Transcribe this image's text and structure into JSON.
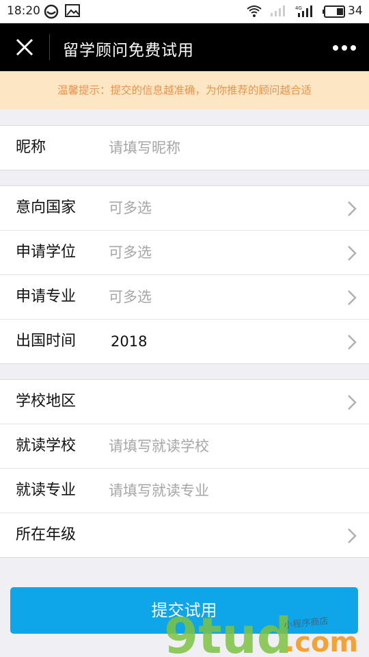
{
  "status_bar": {
    "time": "18:20",
    "battery": "34"
  },
  "header": {
    "title": "留学顾问免费试用"
  },
  "notice": {
    "text": "温馨提示：提交的信息越准确，为你推荐的顾问越合适"
  },
  "groups": [
    {
      "rows": [
        {
          "label": "昵称",
          "placeholder": "请填写昵称"
        }
      ]
    },
    {
      "rows": [
        {
          "label": "意向国家",
          "value": "可多选"
        },
        {
          "label": "申请学位",
          "value": "可多选"
        },
        {
          "label": "申请专业",
          "value": "可多选"
        },
        {
          "label": "出国时间",
          "value": "2018"
        }
      ]
    },
    {
      "rows": [
        {
          "label": "学校地区",
          "value": ""
        },
        {
          "label": "就读学校",
          "placeholder": "请填写就读学校"
        },
        {
          "label": "就读专业",
          "placeholder": "请填写就读专业"
        },
        {
          "label": "所在年级",
          "value": ""
        }
      ]
    }
  ],
  "submit": {
    "label": "提交试用"
  },
  "watermark": {
    "brand": "9tud",
    "tld": ".com",
    "tagline": "小程序商店"
  },
  "colors": {
    "accent": "#0ea5e9",
    "notice_bg": "#fde6c4",
    "notice_text": "#e8944c"
  }
}
